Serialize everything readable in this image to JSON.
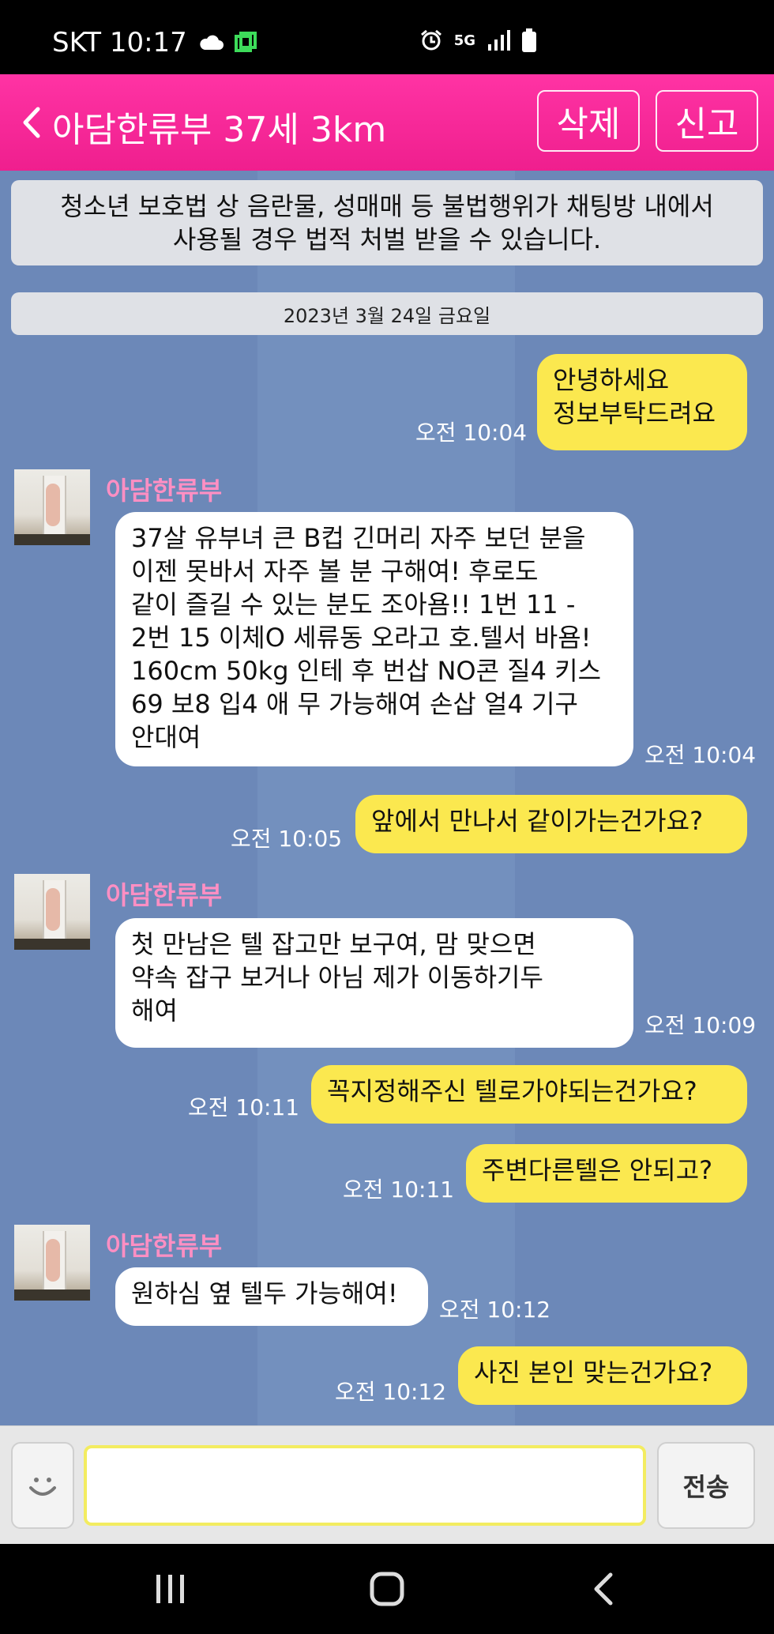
{
  "status_bar": {
    "carrier_time": "SKT 10:17",
    "network": "5G"
  },
  "header": {
    "title": "아담한류부 37세 3km",
    "delete_label": "삭제",
    "report_label": "신고",
    "bg_color": "#f0228f"
  },
  "notice": "청소년 보호법 상 음란물, 성매매 등 불법행위가 채팅방 내에서\n사용될 경우 법적 처벌 받을 수 있습니다.",
  "date_divider": "2023년 3월 24일 금요일",
  "messages": [
    {
      "from": "me",
      "text": "안녕하세요\n정보부탁드려요",
      "time": "오전 10:04"
    },
    {
      "from": "other",
      "name": "아담한류부",
      "text": "37살 유부녀 큰 B컵 긴머리 자주 보던 분을\n이젠 못바서 자주 볼 분 구해여! 후로도\n같이 즐길 수 있는 분도 조아욤!! 1번 11 -\n2번 15 이체O 세류동 오라고 호.텔서 바욤!\n160cm 50kg 인테 후 번삽 NO콘 질4 키스\n69 보8 입4 애 무 가능해여  손삽 얼4 기구\n안대여",
      "time": "오전 10:04"
    },
    {
      "from": "me",
      "text": "앞에서 만나서 같이가는건가요?",
      "time": "오전 10:05"
    },
    {
      "from": "other",
      "name": "아담한류부",
      "text": "첫 만남은 텔 잡고만 보구여, 맘 맞으면\n약속 잡구 보거나 아님 제가 이동하기두\n해여",
      "time": "오전 10:09"
    },
    {
      "from": "me",
      "text": "꼭지정해주신 텔로가야되는건가요?",
      "time": "오전 10:11"
    },
    {
      "from": "me",
      "text": "주변다른텔은 안되고?",
      "time": "오전 10:11"
    },
    {
      "from": "other",
      "name": "아담한류부",
      "text": "원하심 옆 텔두 가능해여!",
      "time": "오전 10:12"
    },
    {
      "from": "me",
      "text": "사진 본인 맞는건가요?",
      "time": "오전 10:12"
    }
  ],
  "input": {
    "value": "",
    "placeholder": ""
  },
  "send_label": "전송",
  "colors": {
    "chat_bg": "#6c88b8",
    "my_bubble": "#fbe84f",
    "other_bubble": "#ffffff",
    "name_pink": "#ff8fc3"
  }
}
